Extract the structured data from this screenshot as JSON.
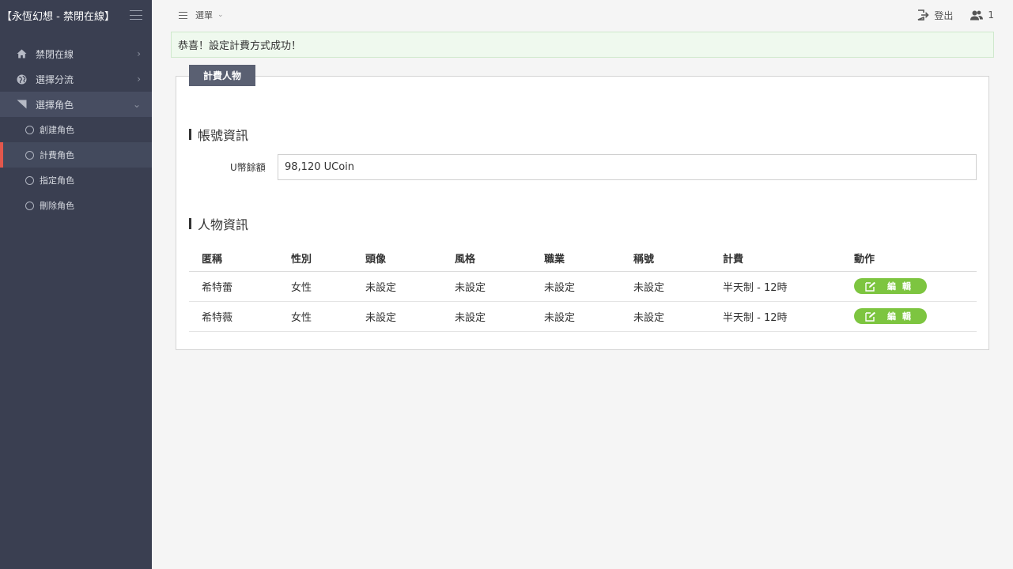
{
  "brand": {
    "title": "【永恆幻想 - 禁閉在線】"
  },
  "sidebar": {
    "items": [
      {
        "label": "禁閉在線",
        "icon": "home-icon"
      },
      {
        "label": "選擇分流",
        "icon": "globe-icon"
      },
      {
        "label": "選擇角色",
        "icon": "corner-icon"
      }
    ],
    "subitems": [
      {
        "label": "創建角色"
      },
      {
        "label": "計費角色"
      },
      {
        "label": "指定角色"
      },
      {
        "label": "刪除角色"
      }
    ]
  },
  "topbar": {
    "menu_label": "選單",
    "logout_label": "登出",
    "user_count": "1"
  },
  "alert": {
    "message": "恭喜！設定計費方式成功！"
  },
  "panel": {
    "tab_label": "計費人物",
    "account_section": "帳號資訊",
    "balance_label": "U幣餘額",
    "balance_value": "98,120 UCoin",
    "character_section": "人物資訊"
  },
  "table": {
    "headers": [
      "匿稱",
      "性別",
      "頭像",
      "風格",
      "職業",
      "稱號",
      "計費",
      "動作"
    ],
    "rows": [
      [
        "希特蕾",
        "女性",
        "未設定",
        "未設定",
        "未設定",
        "未設定",
        "半天制 - 12時"
      ],
      [
        "希特薇",
        "女性",
        "未設定",
        "未設定",
        "未設定",
        "未設定",
        "半天制 - 12時"
      ]
    ],
    "edit_label": "編輯"
  },
  "colors": {
    "sidebar_bg": "#3a3f51",
    "active_marker": "#e2574c",
    "edit_button": "#7dc540",
    "tab_bg": "#5a6072"
  }
}
